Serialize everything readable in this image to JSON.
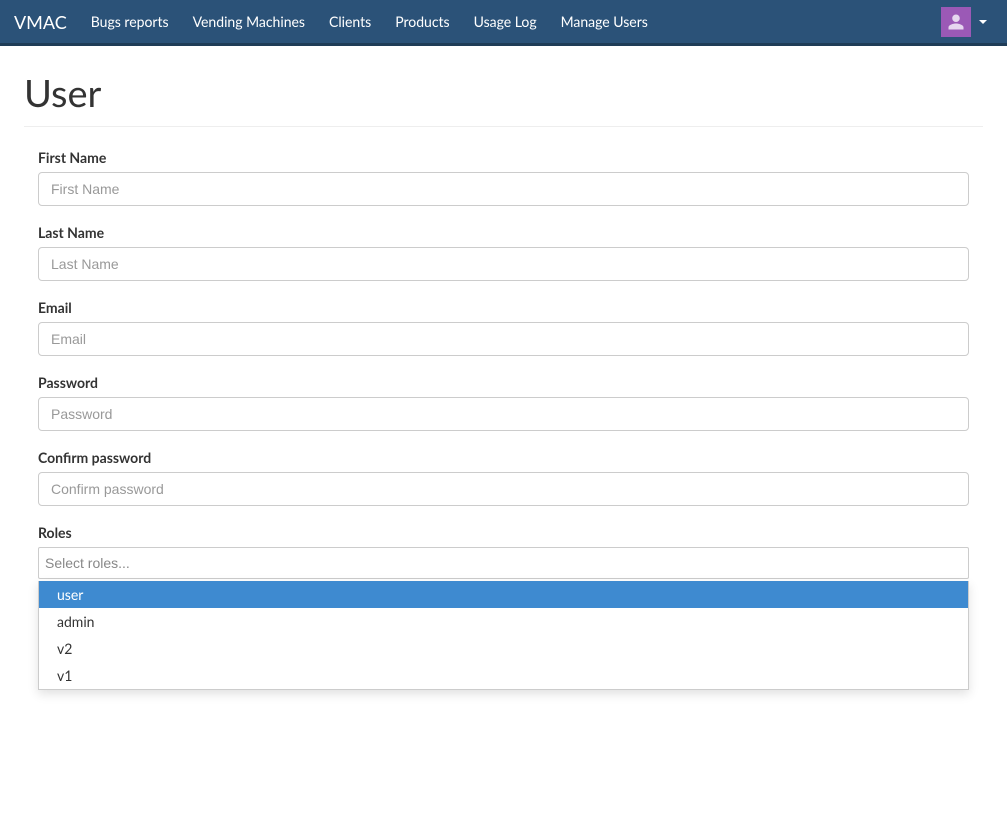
{
  "nav": {
    "brand": "VMAC",
    "items": [
      {
        "label": "Bugs reports"
      },
      {
        "label": "Vending Machines"
      },
      {
        "label": "Clients"
      },
      {
        "label": "Products"
      },
      {
        "label": "Usage Log"
      },
      {
        "label": "Manage Users"
      }
    ]
  },
  "page": {
    "title": "User"
  },
  "form": {
    "first_name": {
      "label": "First Name",
      "placeholder": "First Name",
      "value": ""
    },
    "last_name": {
      "label": "Last Name",
      "placeholder": "Last Name",
      "value": ""
    },
    "email": {
      "label": "Email",
      "placeholder": "Email",
      "value": ""
    },
    "password": {
      "label": "Password",
      "placeholder": "Password",
      "value": ""
    },
    "confirm": {
      "label": "Confirm password",
      "placeholder": "Confirm password",
      "value": ""
    },
    "roles": {
      "label": "Roles",
      "placeholder": "Select roles...",
      "value": "",
      "options": [
        "user",
        "admin",
        "v2",
        "v1"
      ],
      "highlighted_index": 0
    }
  }
}
